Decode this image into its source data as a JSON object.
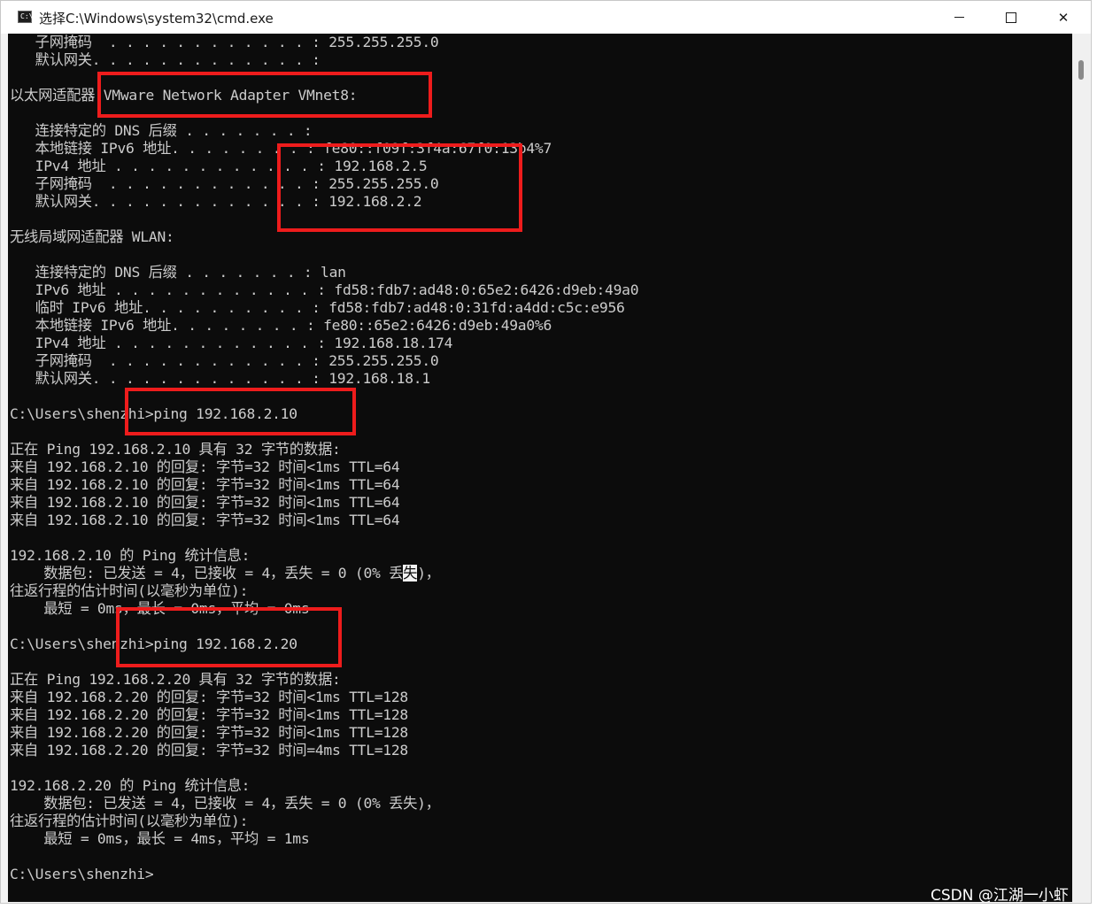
{
  "window": {
    "title": "选择C:\\Windows\\system32\\cmd.exe",
    "app_icon_text": "C:\\",
    "controls": {
      "minimize": "minimize",
      "maximize": "maximize",
      "close": "✕"
    }
  },
  "console": {
    "lines": [
      "   子网掩码  . . . . . . . . . . . . : 255.255.255.0",
      "   默认网关. . . . . . . . . . . . . :",
      "",
      "以太网适配器 VMware Network Adapter VMnet8:",
      "",
      "   连接特定的 DNS 后缀 . . . . . . . :",
      "   本地链接 IPv6 地址. . . . . . . . : fe80::f09f:3f4a:67f0:13b4%7",
      "   IPv4 地址 . . . . . . . . . . . . : 192.168.2.5",
      "   子网掩码  . . . . . . . . . . . . : 255.255.255.0",
      "   默认网关. . . . . . . . . . . . . : 192.168.2.2",
      "",
      "无线局域网适配器 WLAN:",
      "",
      "   连接特定的 DNS 后缀 . . . . . . . : lan",
      "   IPv6 地址 . . . . . . . . . . . . : fd58:fdb7:ad48:0:65e2:6426:d9eb:49a0",
      "   临时 IPv6 地址. . . . . . . . . . : fd58:fdb7:ad48:0:31fd:a4dd:c5c:e956",
      "   本地链接 IPv6 地址. . . . . . . . : fe80::65e2:6426:d9eb:49a0%6",
      "   IPv4 地址 . . . . . . . . . . . . : 192.168.18.174",
      "   子网掩码  . . . . . . . . . . . . : 255.255.255.0",
      "   默认网关. . . . . . . . . . . . . : 192.168.18.1",
      "",
      "C:\\Users\\shenzhi>ping 192.168.2.10",
      "",
      "正在 Ping 192.168.2.10 具有 32 字节的数据:",
      "来自 192.168.2.10 的回复: 字节=32 时间<1ms TTL=64",
      "来自 192.168.2.10 的回复: 字节=32 时间<1ms TTL=64",
      "来自 192.168.2.10 的回复: 字节=32 时间<1ms TTL=64",
      "来自 192.168.2.10 的回复: 字节=32 时间<1ms TTL=64",
      "",
      "192.168.2.10 的 Ping 统计信息:",
      "    数据包: 已发送 = 4，已接收 = 4，丢失 = 0 (0% 丢失)，",
      "往返行程的估计时间(以毫秒为单位):",
      "    最短 = 0ms，最长 = 0ms，平均 = 0ms",
      "",
      "C:\\Users\\shenzhi>ping 192.168.2.20",
      "",
      "正在 Ping 192.168.2.20 具有 32 字节的数据:",
      "来自 192.168.2.20 的回复: 字节=32 时间<1ms TTL=128",
      "来自 192.168.2.20 的回复: 字节=32 时间<1ms TTL=128",
      "来自 192.168.2.20 的回复: 字节=32 时间<1ms TTL=128",
      "来自 192.168.2.20 的回复: 字节=32 时间=4ms TTL=128",
      "",
      "192.168.2.20 的 Ping 统计信息:",
      "    数据包: 已发送 = 4，已接收 = 4，丢失 = 0 (0% 丢失)，",
      "往返行程的估计时间(以毫秒为单位):",
      "    最短 = 0ms，最长 = 4ms，平均 = 1ms",
      "",
      "C:\\Users\\shenzhi>"
    ],
    "selection": {
      "line": 30,
      "text": "失"
    },
    "foreground_color": "#cccccc",
    "background_color": "#0c0c0c"
  },
  "annotations": {
    "box_color": "#ee1c1c"
  },
  "watermark": "CSDN @江湖一小虾"
}
